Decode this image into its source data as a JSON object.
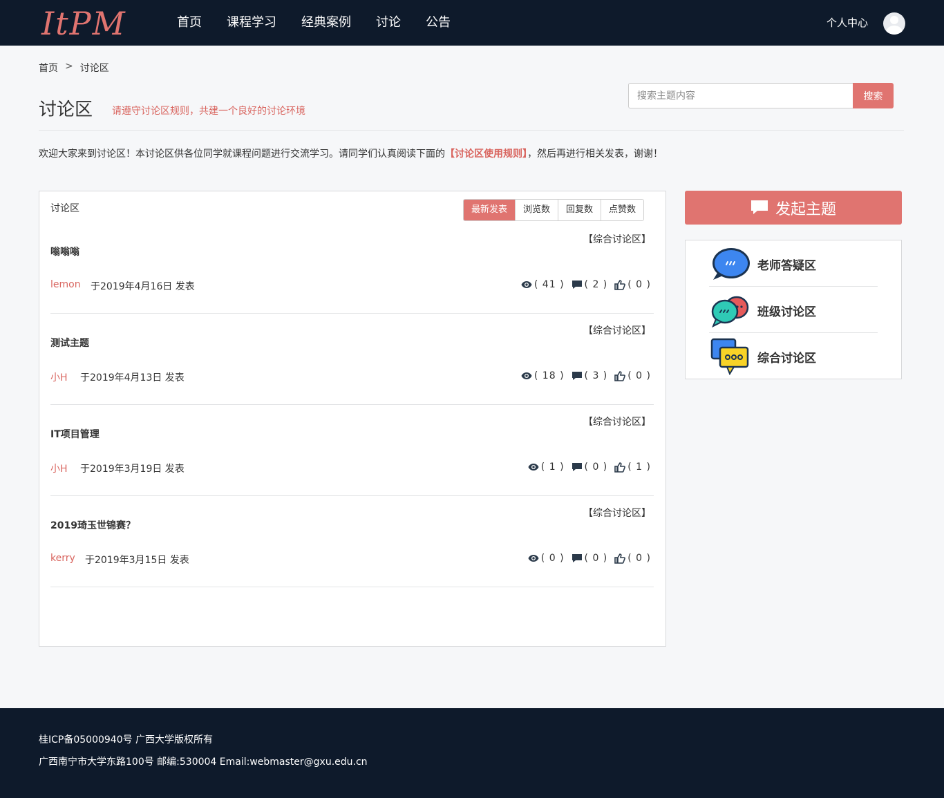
{
  "header": {
    "logo_text": "ItPM",
    "nav": [
      "首页",
      "课程学习",
      "经典案例",
      "讨论",
      "公告"
    ],
    "user_center": "个人中心"
  },
  "breadcrumb": {
    "home": "首页",
    "separator": ">",
    "current": "讨论区"
  },
  "page": {
    "title": "讨论区",
    "subtitle": "请遵守讨论区规则，共建一个良好的讨论环境"
  },
  "search": {
    "placeholder": "搜索主题内容",
    "button": "搜索"
  },
  "welcome": {
    "before": "欢迎大家来到讨论区！本讨论区供各位同学就课程问题进行交流学习。请同学们认真阅读下面的",
    "rules_link": "【讨论区使用规则】",
    "after": "，然后再进行相关发表，谢谢！"
  },
  "panel": {
    "title": "讨论区",
    "sort_options": [
      "最新发表",
      "浏览数",
      "回复数",
      "点赞数"
    ],
    "active_sort": "最新发表"
  },
  "topics": [
    {
      "category": "【综合讨论区】",
      "title": "嗡嗡嗡",
      "author": "lemon",
      "date": "于2019年4月16日 发表",
      "views": "( 41 )",
      "replies": "( 2 )",
      "likes": "( 0 )"
    },
    {
      "category": "【综合讨论区】",
      "title": "测试主题",
      "author": "小H",
      "date": "于2019年4月13日 发表",
      "views": "( 18 )",
      "replies": "( 3 )",
      "likes": "( 0 )"
    },
    {
      "category": "【综合讨论区】",
      "title": "IT项目管理",
      "author": "小H",
      "date": "于2019年3月19日 发表",
      "views": "( 1 )",
      "replies": "( 0 )",
      "likes": "( 1 )"
    },
    {
      "category": "【综合讨论区】",
      "title": "2019琦玉世锦赛？",
      "author": "kerry",
      "date": "于2019年3月15日 发表",
      "views": "( 0 )",
      "replies": "( 0 )",
      "likes": "( 0 )"
    }
  ],
  "sidebar": {
    "new_topic_button": "发起主题",
    "categories": [
      "老师答疑区",
      "班级讨论区",
      "综合讨论区"
    ]
  },
  "footer": {
    "line1": "桂ICP备05000940号 广西大学版权所有",
    "line2": "广西南宁市大学东路100号 邮编:530004 Email:webmaster@gxu.edu.cn"
  },
  "colors": {
    "accent": "#e07470",
    "header_bg": "#0e1a2b",
    "page_bg": "#f6f7f9"
  }
}
